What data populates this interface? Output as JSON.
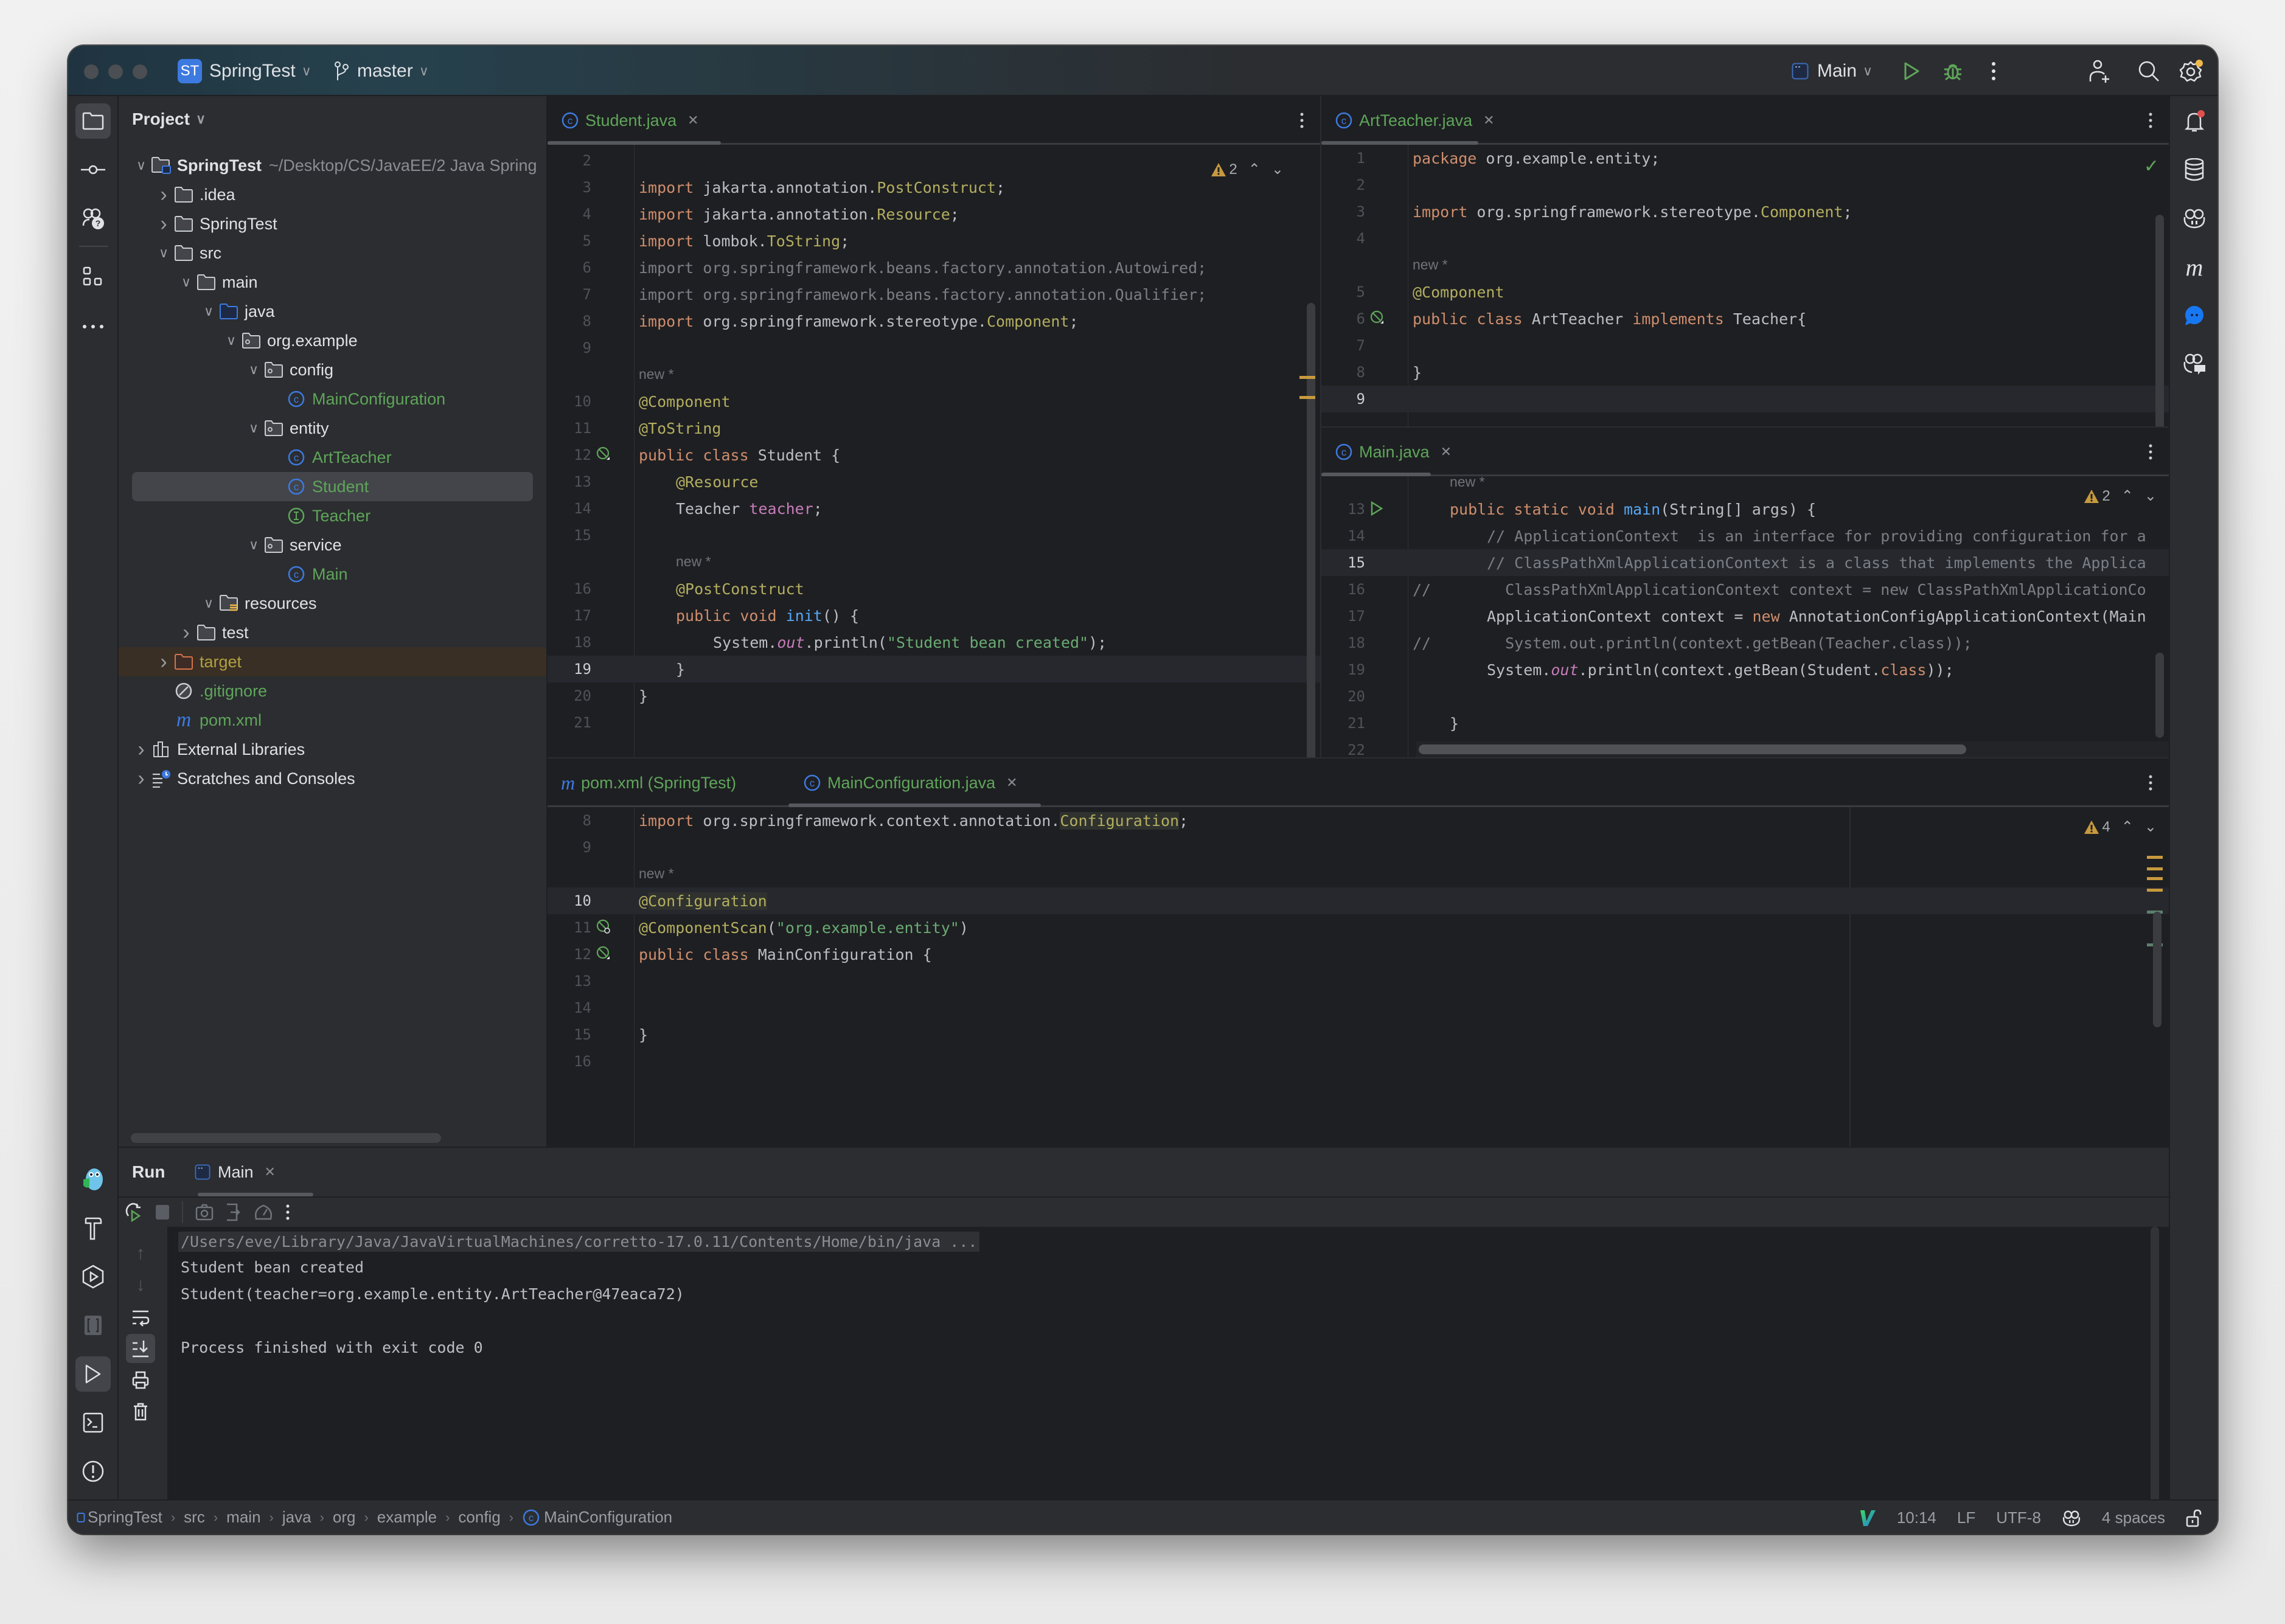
{
  "titlebar": {
    "project_badge": "ST",
    "project_name": "SpringTest",
    "branch": "master",
    "run_config": "Main",
    "icons": [
      "run-icon",
      "debug-icon",
      "more-icon",
      "add-user-icon",
      "search-icon",
      "settings-icon"
    ]
  },
  "project_panel": {
    "title": "Project",
    "tree": [
      {
        "label": "SpringTest",
        "extra": "~/Desktop/CS/JavaEE/2 Java Spring",
        "depth": 0,
        "expanded": true,
        "icon": "module-folder",
        "bold": true
      },
      {
        "label": ".idea",
        "depth": 1,
        "expanded": false,
        "icon": "folder"
      },
      {
        "label": "SpringTest",
        "depth": 1,
        "expanded": false,
        "icon": "folder"
      },
      {
        "label": "src",
        "depth": 1,
        "expanded": true,
        "icon": "folder"
      },
      {
        "label": "main",
        "depth": 2,
        "expanded": true,
        "icon": "folder"
      },
      {
        "label": "java",
        "depth": 3,
        "expanded": true,
        "icon": "source-folder"
      },
      {
        "label": "org.example",
        "depth": 4,
        "expanded": true,
        "icon": "package"
      },
      {
        "label": "config",
        "depth": 5,
        "expanded": true,
        "icon": "package"
      },
      {
        "label": "MainConfiguration",
        "depth": 6,
        "icon": "class",
        "color": "green"
      },
      {
        "label": "entity",
        "depth": 5,
        "expanded": true,
        "icon": "package"
      },
      {
        "label": "ArtTeacher",
        "depth": 6,
        "icon": "class",
        "color": "green"
      },
      {
        "label": "Student",
        "depth": 6,
        "icon": "class",
        "color": "green",
        "selected": true
      },
      {
        "label": "Teacher",
        "depth": 6,
        "icon": "interface",
        "color": "green"
      },
      {
        "label": "service",
        "depth": 5,
        "expanded": true,
        "icon": "package"
      },
      {
        "label": "Main",
        "depth": 6,
        "icon": "class",
        "color": "green"
      },
      {
        "label": "resources",
        "depth": 3,
        "expanded": true,
        "icon": "resources-folder"
      },
      {
        "label": "test",
        "depth": 2,
        "expanded": false,
        "icon": "folder"
      },
      {
        "label": "target",
        "depth": 1,
        "expanded": false,
        "icon": "excluded-folder",
        "color": "olive",
        "excluded": true
      },
      {
        "label": ".gitignore",
        "depth": 1,
        "icon": "ignore-file",
        "color": "green"
      },
      {
        "label": "pom.xml",
        "depth": 1,
        "icon": "maven",
        "color": "green"
      },
      {
        "label": "External Libraries",
        "depth": 0,
        "expanded": false,
        "icon": "libraries"
      },
      {
        "label": "Scratches and Consoles",
        "depth": 0,
        "expanded": false,
        "icon": "scratches"
      }
    ]
  },
  "editors": {
    "student": {
      "tab": "Student.java",
      "warnings": "2",
      "lines": [
        {
          "n": "2",
          "tokens": []
        },
        {
          "n": "3",
          "tokens": [
            [
              "kw",
              "import"
            ],
            [
              "",
              "jakarta.annotation."
            ],
            [
              "an",
              "PostConstruct"
            ],
            [
              "",
              ";"
            ]
          ]
        },
        {
          "n": "4",
          "tokens": [
            [
              "kw",
              "import"
            ],
            [
              "",
              "jakarta.annotation."
            ],
            [
              "an",
              "Resource"
            ],
            [
              "",
              ";"
            ]
          ]
        },
        {
          "n": "5",
          "tokens": [
            [
              "kw",
              "import"
            ],
            [
              "",
              "lombok."
            ],
            [
              "an",
              "ToString"
            ],
            [
              "",
              ";"
            ]
          ]
        },
        {
          "n": "6",
          "tokens": [
            [
              "cm",
              "import org.springframework.beans.factory.annotation.Autowired;"
            ]
          ]
        },
        {
          "n": "7",
          "tokens": [
            [
              "cm",
              "import org.springframework.beans.factory.annotation.Qualifier;"
            ]
          ]
        },
        {
          "n": "8",
          "tokens": [
            [
              "kw",
              "import"
            ],
            [
              "",
              "org.springframework.stereotype."
            ],
            [
              "an",
              "Component"
            ],
            [
              "",
              ";"
            ]
          ]
        },
        {
          "n": "9",
          "tokens": []
        },
        {
          "hint": "new *",
          "indent": 0
        },
        {
          "n": "10",
          "tokens": [
            [
              "an",
              "@Component"
            ]
          ]
        },
        {
          "n": "11",
          "tokens": [
            [
              "an",
              "@ToString"
            ]
          ]
        },
        {
          "n": "12",
          "gutter": "bean",
          "tokens": [
            [
              "kw",
              "public class"
            ],
            [
              "",
              "Student {"
            ]
          ]
        },
        {
          "n": "13",
          "indent": 1,
          "tokens": [
            [
              "an",
              "@Resource"
            ]
          ]
        },
        {
          "n": "14",
          "indent": 1,
          "tokens": [
            [
              "",
              "Teacher"
            ],
            [
              "fld",
              "teacher"
            ],
            [
              "",
              ";"
            ]
          ]
        },
        {
          "n": "15",
          "tokens": []
        },
        {
          "hint": "new *",
          "indent": 1
        },
        {
          "n": "16",
          "indent": 1,
          "tokens": [
            [
              "an",
              "@PostConstruct"
            ]
          ]
        },
        {
          "n": "17",
          "indent": 1,
          "tokens": [
            [
              "kw",
              "public void"
            ],
            [
              "fn",
              "init"
            ],
            [
              "",
              "() {"
            ]
          ]
        },
        {
          "n": "18",
          "indent": 2,
          "tokens": [
            [
              "",
              "System."
            ],
            [
              "fld it",
              "out"
            ],
            [
              "",
              ".println("
            ],
            [
              "str",
              "\"Student bean created\""
            ],
            [
              "",
              ");"
            ]
          ]
        },
        {
          "n": "19",
          "indent": 1,
          "current": true,
          "tokens": [
            [
              "",
              "}"
            ]
          ]
        },
        {
          "n": "20",
          "tokens": [
            [
              "",
              "}"
            ]
          ]
        },
        {
          "n": "21",
          "tokens": []
        }
      ]
    },
    "artteacher": {
      "tab": "ArtTeacher.java",
      "lines": [
        {
          "n": "1",
          "tokens": [
            [
              "kw",
              "package"
            ],
            [
              "",
              "org.example.entity;"
            ]
          ]
        },
        {
          "n": "2",
          "tokens": []
        },
        {
          "n": "3",
          "tokens": [
            [
              "kw",
              "import"
            ],
            [
              "",
              "org.springframework.stereotype."
            ],
            [
              "an",
              "Component"
            ],
            [
              "",
              ";"
            ]
          ]
        },
        {
          "n": "4",
          "tokens": []
        },
        {
          "hint": "new *",
          "indent": 0
        },
        {
          "n": "5",
          "tokens": [
            [
              "an",
              "@Component"
            ]
          ]
        },
        {
          "n": "6",
          "gutter": "bean",
          "tokens": [
            [
              "kw",
              "public class"
            ],
            [
              "",
              "ArtTeacher"
            ],
            [
              "kw",
              "implements"
            ],
            [
              "",
              "Teacher{"
            ]
          ]
        },
        {
          "n": "7",
          "tokens": []
        },
        {
          "n": "8",
          "tokens": [
            [
              "",
              "}"
            ]
          ]
        },
        {
          "n": "9",
          "current": true,
          "tokens": []
        }
      ]
    },
    "main": {
      "tab": "Main.java",
      "warnings": "2",
      "lines": [
        {
          "hint": "new *",
          "indent": 1
        },
        {
          "n": "13",
          "gutter": "run",
          "indent": 1,
          "tokens": [
            [
              "kw",
              "public static void"
            ],
            [
              "fn",
              "main"
            ],
            [
              "",
              "(String[] args) {"
            ]
          ]
        },
        {
          "n": "14",
          "indent": 2,
          "tokens": [
            [
              "cm",
              "// ApplicationContext  is an interface for providing configuration for a"
            ]
          ]
        },
        {
          "n": "15",
          "indent": 2,
          "current": true,
          "tokens": [
            [
              "cm",
              "// ClassPathXmlApplicationContext is a class that implements the Applica"
            ]
          ]
        },
        {
          "n": "16",
          "prefix": "//",
          "indent": 2,
          "tokens": [
            [
              "cm",
              "  ClassPathXmlApplicationContext context = new ClassPathXmlApplicationCo"
            ]
          ]
        },
        {
          "n": "17",
          "indent": 2,
          "tokens": [
            [
              "",
              "ApplicationContext context = "
            ],
            [
              "kw",
              "new"
            ],
            [
              "",
              "AnnotationConfigApplicationContext(Main"
            ]
          ]
        },
        {
          "n": "18",
          "prefix": "//",
          "indent": 2,
          "tokens": [
            [
              "cm",
              "  System.out.println(context.getBean(Teacher.class));"
            ]
          ]
        },
        {
          "n": "19",
          "indent": 2,
          "tokens": [
            [
              "",
              "System."
            ],
            [
              "fld it",
              "out"
            ],
            [
              "",
              ".println(context.getBean(Student."
            ],
            [
              "kw",
              "class"
            ],
            [
              "",
              "));"
            ]
          ]
        },
        {
          "n": "20",
          "tokens": []
        },
        {
          "n": "21",
          "indent": 1,
          "tokens": [
            [
              "",
              "}"
            ]
          ]
        },
        {
          "n": "22",
          "tokens": []
        }
      ]
    },
    "bottom": {
      "tabs": [
        {
          "label": "pom.xml (SpringTest)",
          "icon": "maven",
          "active": false
        },
        {
          "label": "MainConfiguration.java",
          "icon": "class",
          "active": true
        }
      ],
      "warnings": "4",
      "lines": [
        {
          "n": "8",
          "tokens": [
            [
              "kw",
              "import"
            ],
            [
              "",
              "org.springframework.context.annotation."
            ],
            [
              "an hl",
              "Configuration"
            ],
            [
              "",
              ";"
            ]
          ]
        },
        {
          "n": "9",
          "tokens": []
        },
        {
          "hint": "new *",
          "indent": 0
        },
        {
          "n": "10",
          "current": true,
          "tokens": [
            [
              "an",
              "@"
            ],
            [
              "an hl",
              "Configuration"
            ]
          ]
        },
        {
          "n": "11",
          "gutter": "scan",
          "tokens": [
            [
              "an",
              "@ComponentScan"
            ],
            [
              "",
              "("
            ],
            [
              "str",
              "\"org.example.entity\""
            ],
            [
              "",
              ")"
            ]
          ]
        },
        {
          "n": "12",
          "gutter": "bean",
          "tokens": [
            [
              "kw",
              "public class"
            ],
            [
              "",
              "MainConfiguration {"
            ]
          ]
        },
        {
          "n": "13",
          "tokens": []
        },
        {
          "n": "14",
          "tokens": []
        },
        {
          "n": "15",
          "tokens": [
            [
              "",
              "}"
            ]
          ]
        },
        {
          "n": "16",
          "tokens": []
        }
      ]
    }
  },
  "run": {
    "title": "Run",
    "tab": "Main",
    "console": [
      {
        "text": "/Users/eve/Library/Java/JavaVirtualMachines/corretto-17.0.11/Contents/Home/bin/java ...",
        "kind": "cmd"
      },
      {
        "text": "Student bean created",
        "kind": "out"
      },
      {
        "text": "Student(teacher=org.example.entity.ArtTeacher@47eaca72)",
        "kind": "out"
      },
      {
        "text": "",
        "kind": "out"
      },
      {
        "text": "Process finished with exit code 0",
        "kind": "out"
      }
    ]
  },
  "statusbar": {
    "breadcrumb": [
      "SpringTest",
      "src",
      "main",
      "java",
      "org",
      "example",
      "config",
      "MainConfiguration"
    ],
    "position": "10:14",
    "line_ending": "LF",
    "encoding": "UTF-8",
    "indent": "4 spaces"
  },
  "colors": {
    "accent": "#3d7ae0",
    "run_green": "#5fa55a",
    "warning": "#c79a3e",
    "notification_dot": "#e0504e"
  }
}
